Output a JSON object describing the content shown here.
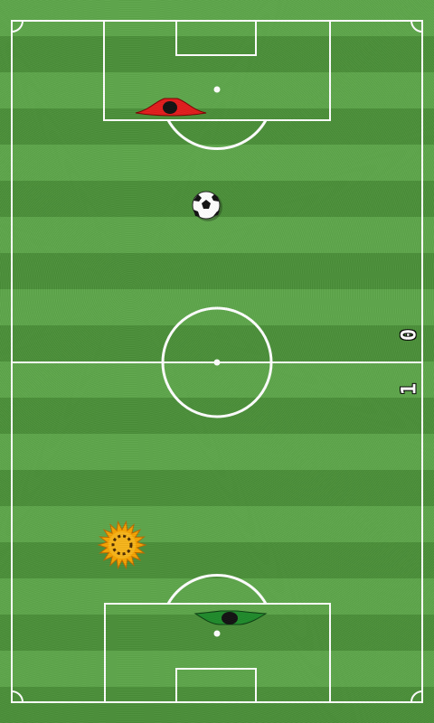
{
  "scoreboard": {
    "top_score": "0",
    "bottom_score": "1"
  },
  "colors": {
    "line": "#ffffff",
    "top_paddle": "#e21b1b",
    "bottom_paddle": "#1e8a2a",
    "spiky_powerup": "#f5a300"
  },
  "icons": {
    "ball": "soccer-ball-icon",
    "top_paddle": "red-paddle-icon",
    "bottom_paddle": "green-paddle-icon",
    "powerup": "spiky-sun-icon"
  }
}
